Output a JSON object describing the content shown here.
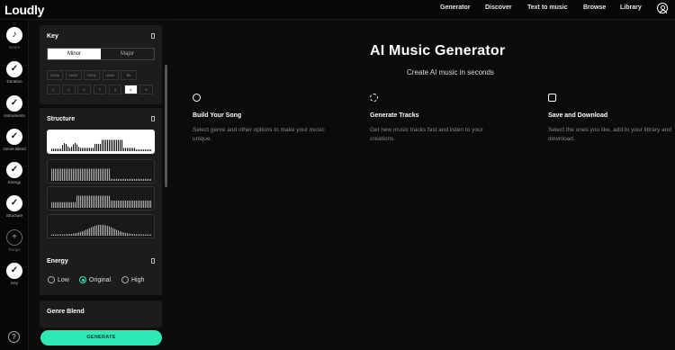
{
  "brand": "Loudly",
  "nav": [
    "Generator",
    "Discover",
    "Text to music",
    "Browse",
    "Library"
  ],
  "steps": [
    {
      "label": "Genre",
      "done": false,
      "glyph": "♪"
    },
    {
      "label": "Duration",
      "done": true,
      "glyph": "✓"
    },
    {
      "label": "Instruments",
      "done": true,
      "glyph": "✓"
    },
    {
      "label": "Genre Blend",
      "done": true,
      "glyph": "✓"
    },
    {
      "label": "Energy",
      "done": true,
      "glyph": "✓"
    },
    {
      "label": "Structure",
      "done": true,
      "glyph": "✓"
    },
    {
      "label": "Tempo",
      "done": false,
      "glyph": "+"
    },
    {
      "label": "Key",
      "done": true,
      "glyph": "✓"
    }
  ],
  "help_glyph": "?",
  "key_card": {
    "title": "Key",
    "modes": [
      "Minor",
      "Major"
    ],
    "selected_mode": "Minor",
    "sharps": [
      "C#/Db",
      "D#/Eb",
      "F#/Gb",
      "G#/Ab",
      "Bb"
    ],
    "naturals": [
      "C",
      "D",
      "E",
      "F",
      "G",
      "A",
      "B"
    ],
    "selected_note": "A"
  },
  "structure_card": {
    "title": "Structure",
    "selected_index": 0
  },
  "energy_card": {
    "title": "Energy",
    "options": [
      "Low",
      "Original",
      "High"
    ],
    "selected": "Original"
  },
  "genre_blend_card": {
    "title": "Genre Blend"
  },
  "generate_label": "GENERATE",
  "accent": "#2ee8b6",
  "hero": {
    "title": "AI Music Generator",
    "subtitle": "Create AI music in seconds"
  },
  "features": [
    {
      "icon": "palette-icon",
      "title": "Build Your Song",
      "desc": "Select genre and other options to make your music unique."
    },
    {
      "icon": "refresh-icon",
      "title": "Generate Tracks",
      "desc": "Get new music tracks fast and listen to your creations."
    },
    {
      "icon": "heart-download-icon",
      "title": "Save and Download",
      "desc": "Select the ones you like, add to your library and download."
    }
  ]
}
